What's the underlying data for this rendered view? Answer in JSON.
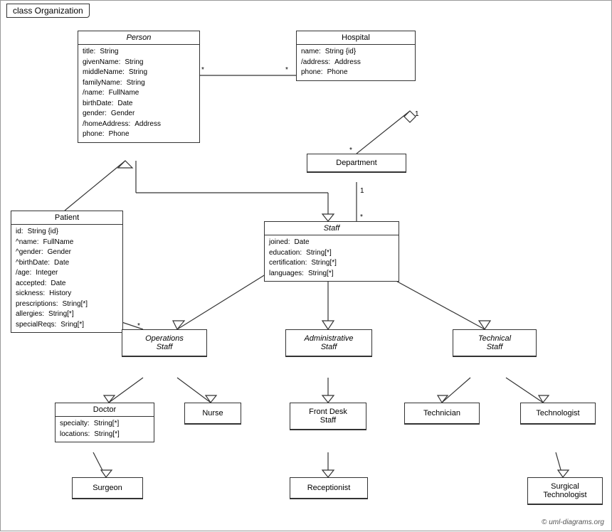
{
  "title": "class Organization",
  "copyright": "© uml-diagrams.org",
  "boxes": {
    "person": {
      "label": "Person",
      "italic": true,
      "attrs": [
        [
          "title:",
          "String"
        ],
        [
          "givenName:",
          "String"
        ],
        [
          "middleName:",
          "String"
        ],
        [
          "familyName:",
          "String"
        ],
        [
          "/name:",
          "FullName"
        ],
        [
          "birthDate:",
          "Date"
        ],
        [
          "gender:",
          "Gender"
        ],
        [
          "/homeAddress:",
          "Address"
        ],
        [
          "phone:",
          "Phone"
        ]
      ]
    },
    "hospital": {
      "label": "Hospital",
      "italic": false,
      "attrs": [
        [
          "name:",
          "String {id}"
        ],
        [
          "/address:",
          "Address"
        ],
        [
          "phone:",
          "Phone"
        ]
      ]
    },
    "department": {
      "label": "Department",
      "italic": false,
      "attrs": []
    },
    "staff": {
      "label": "Staff",
      "italic": true,
      "attrs": [
        [
          "joined:",
          "Date"
        ],
        [
          "education:",
          "String[*]"
        ],
        [
          "certification:",
          "String[*]"
        ],
        [
          "languages:",
          "String[*]"
        ]
      ]
    },
    "patient": {
      "label": "Patient",
      "italic": false,
      "attrs": [
        [
          "id:",
          "String {id}"
        ],
        [
          "^name:",
          "FullName"
        ],
        [
          "^gender:",
          "Gender"
        ],
        [
          "^birthDate:",
          "Date"
        ],
        [
          "/age:",
          "Integer"
        ],
        [
          "accepted:",
          "Date"
        ],
        [
          "sickness:",
          "History"
        ],
        [
          "prescriptions:",
          "String[*]"
        ],
        [
          "allergies:",
          "String[*]"
        ],
        [
          "specialReqs:",
          "Sring[*]"
        ]
      ]
    },
    "operations_staff": {
      "label": "Operations Staff",
      "italic": true,
      "attrs": []
    },
    "administrative_staff": {
      "label": "Administrative Staff",
      "italic": true,
      "attrs": []
    },
    "technical_staff": {
      "label": "Technical Staff",
      "italic": true,
      "attrs": []
    },
    "doctor": {
      "label": "Doctor",
      "italic": false,
      "attrs": [
        [
          "specialty:",
          "String[*]"
        ],
        [
          "locations:",
          "String[*]"
        ]
      ]
    },
    "nurse": {
      "label": "Nurse",
      "italic": false,
      "attrs": []
    },
    "front_desk_staff": {
      "label": "Front Desk Staff",
      "italic": false,
      "attrs": []
    },
    "technician": {
      "label": "Technician",
      "italic": false,
      "attrs": []
    },
    "technologist": {
      "label": "Technologist",
      "italic": false,
      "attrs": []
    },
    "surgeon": {
      "label": "Surgeon",
      "italic": false,
      "attrs": []
    },
    "receptionist": {
      "label": "Receptionist",
      "italic": false,
      "attrs": []
    },
    "surgical_technologist": {
      "label": "Surgical Technologist",
      "italic": false,
      "attrs": []
    }
  }
}
